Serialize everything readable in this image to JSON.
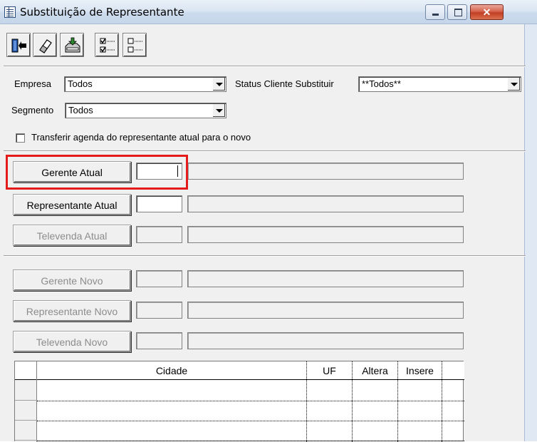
{
  "window": {
    "title": "Substituição de Representante",
    "minimize_glyph": "–",
    "maximize_glyph": "□",
    "close_glyph": "✕"
  },
  "toolbar": {
    "items": [
      {
        "name": "exit-icon"
      },
      {
        "name": "eraser-icon"
      },
      {
        "name": "save-download-icon"
      },
      {
        "name": "check-all-icon"
      },
      {
        "name": "uncheck-all-icon"
      }
    ]
  },
  "filters": {
    "empresa_label": "Empresa",
    "empresa_value": "Todos",
    "status_label": "Status Cliente Substituir",
    "status_value": "**Todos**",
    "segmento_label": "Segmento",
    "segmento_value": "Todos",
    "transfer_label": "Transferir agenda do representante atual para o novo",
    "transfer_checked": false
  },
  "atual": {
    "gerente_label": "Gerente Atual",
    "representante_label": "Representante Atual",
    "televenda_label": "Televenda Atual"
  },
  "novo": {
    "gerente_label": "Gerente Novo",
    "representante_label": "Representante Novo",
    "televenda_label": "Televenda Novo"
  },
  "grid": {
    "columns": [
      "Cidade",
      "UF",
      "Altera",
      "Insere"
    ],
    "rows": [
      [
        "",
        "",
        "",
        ""
      ],
      [
        "",
        "",
        "",
        ""
      ],
      [
        "",
        "",
        "",
        ""
      ]
    ]
  },
  "colors": {
    "highlight": "#e31b1b",
    "close_button": "#c23f24"
  }
}
